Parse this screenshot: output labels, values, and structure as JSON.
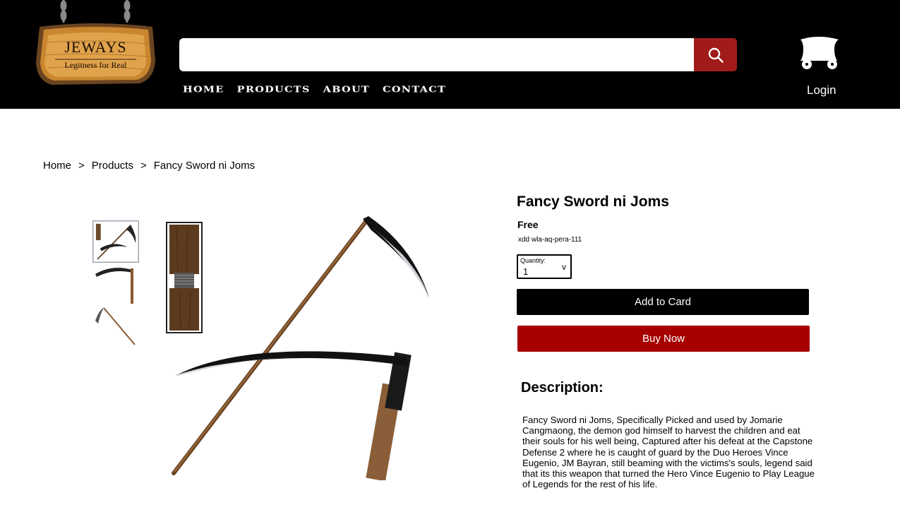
{
  "header": {
    "logo": {
      "title": "JEWAYS",
      "subtitle": "Legitness for Real"
    },
    "search": {
      "placeholder": "",
      "value": "",
      "icon": "search-icon"
    },
    "nav": [
      {
        "label": "HOME"
      },
      {
        "label": "PRODUCTS"
      },
      {
        "label": "ABOUT"
      },
      {
        "label": "CONTACT"
      }
    ],
    "cart_icon": "wagon-cart-icon",
    "login_label": "Login"
  },
  "breadcrumb": [
    {
      "label": "Home"
    },
    {
      "label": "Products"
    },
    {
      "label": "Fancy Sword ni Joms"
    }
  ],
  "breadcrumb_separator": ">",
  "product": {
    "title": "Fancy Sword ni Joms",
    "price": "Free",
    "sku": "xdd wla-aq-pera-111",
    "quantity": {
      "label": "Quantity:",
      "value": "1",
      "arrow": "v"
    },
    "add_to_cart_label": "Add to Card",
    "buy_now_label": "Buy Now",
    "description_heading": "Description:",
    "description": "Fancy Sword ni Joms, Specifically Picked and used by Jomarie Cangmaong, the demon god himself to harvest the children and eat their souls for his well being, Captured after his defeat at the Capstone Defense 2 where he is caught of guard by the Duo Heroes Vince Eugenio, JM Bayran, still beaming with the victims's souls, legend said that its this weapon that turned the Hero Vince Eugenio to Play League of Legends for the rest of his life."
  },
  "colors": {
    "header_bg": "#000000",
    "search_button": "#a11b1b",
    "buy_now": "#a60000",
    "add_to_cart": "#000000"
  }
}
